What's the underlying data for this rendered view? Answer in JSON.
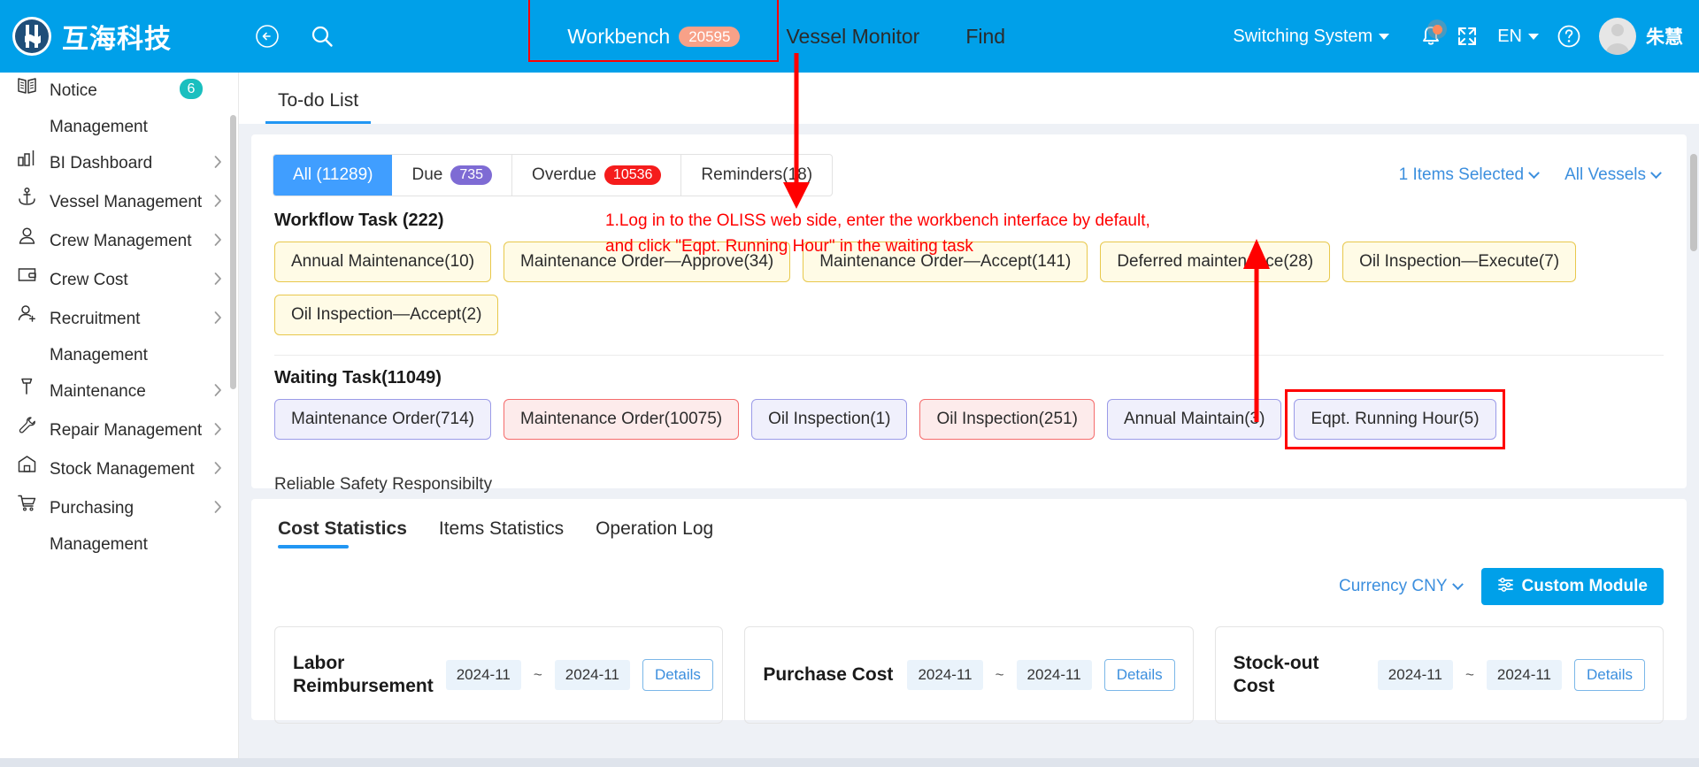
{
  "header": {
    "brand_name": "互海科技",
    "nav": [
      {
        "label": "Workbench",
        "badge": "20595",
        "active": true,
        "highlighted": true
      },
      {
        "label": "Vessel Monitor",
        "badge": "",
        "active": false,
        "highlighted": false
      },
      {
        "label": "Find",
        "badge": "",
        "active": false,
        "highlighted": false
      }
    ],
    "switching_system": "Switching System",
    "language": "EN",
    "username": "朱慧",
    "icons": {
      "back": "back-arrow-icon",
      "search": "search-icon",
      "bell": "notification-bell-icon",
      "fullscreen": "fullscreen-icon",
      "help": "help-circle-icon",
      "avatar": "user-avatar"
    },
    "accent_color": "#00A0E9",
    "badge_color": "#F8A188"
  },
  "sidebar": {
    "items": [
      {
        "label": "Notice\nManagement",
        "icon": "book-icon",
        "badge": "6",
        "chevron": false
      },
      {
        "label": "BI Dashboard",
        "icon": "bar-chart-icon",
        "badge": "",
        "chevron": true
      },
      {
        "label": "Vessel Management",
        "icon": "anchor-icon",
        "badge": "",
        "chevron": true
      },
      {
        "label": "Crew Management",
        "icon": "person-icon",
        "badge": "",
        "chevron": true
      },
      {
        "label": "Crew Cost",
        "icon": "wallet-icon",
        "badge": "",
        "chevron": true
      },
      {
        "label": "Recruitment\nManagement",
        "icon": "person-add-icon",
        "badge": "",
        "chevron": true
      },
      {
        "label": "Maintenance",
        "icon": "hammer-icon",
        "badge": "",
        "chevron": true
      },
      {
        "label": "Repair Management",
        "icon": "wrench-icon",
        "badge": "",
        "chevron": true
      },
      {
        "label": "Stock Management",
        "icon": "warehouse-icon",
        "badge": "",
        "chevron": true
      },
      {
        "label": "Purchasing\nManagement",
        "icon": "cart-icon",
        "badge": "",
        "chevron": true
      }
    ],
    "badge_color": "#1ABFBF"
  },
  "main": {
    "todo_tab": "To-do List",
    "filter_tabs": [
      {
        "label": "All (11289)",
        "pill": "",
        "active": true
      },
      {
        "label": "Due",
        "pill": "735",
        "pill_color": "purple",
        "active": false
      },
      {
        "label": "Overdue",
        "pill": "10536",
        "pill_color": "red",
        "active": false
      },
      {
        "label": "Reminders(18)",
        "pill": "",
        "active": false
      }
    ],
    "items_selected": "1 Items Selected",
    "all_vessels": "All Vessels",
    "workflow_title": "Workflow Task (222)",
    "workflow_chips": [
      {
        "label": "Annual Maintenance(10)",
        "style": "yellow"
      },
      {
        "label": "Maintenance Order—Approve(34)",
        "style": "yellow"
      },
      {
        "label": "Maintenance Order—Accept(141)",
        "style": "yellow"
      },
      {
        "label": "Deferred maintenance(28)",
        "style": "yellow"
      },
      {
        "label": "Oil Inspection—Execute(7)",
        "style": "yellow"
      },
      {
        "label": "Oil Inspection—Accept(2)",
        "style": "yellow"
      }
    ],
    "waiting_title": "Waiting Task(11049)",
    "waiting_chips": [
      {
        "label": "Maintenance Order(714)",
        "style": "blue",
        "highlighted": false
      },
      {
        "label": "Maintenance Order(10075)",
        "style": "pink",
        "highlighted": false
      },
      {
        "label": "Oil Inspection(1)",
        "style": "blue",
        "highlighted": false
      },
      {
        "label": "Oil Inspection(251)",
        "style": "pink",
        "highlighted": false
      },
      {
        "label": "Annual Maintain(3)",
        "style": "blue",
        "highlighted": false
      },
      {
        "label": "Eqpt. Running Hour(5)",
        "style": "blue",
        "highlighted": true
      }
    ],
    "reliable_safety": "Reliable Safety Responsibilty"
  },
  "stats": {
    "tabs": [
      {
        "label": "Cost Statistics",
        "active": true
      },
      {
        "label": "Items Statistics",
        "active": false
      },
      {
        "label": "Operation Log",
        "active": false
      }
    ],
    "currency": "Currency CNY",
    "custom_module": "Custom Module",
    "cost_cards": [
      {
        "name": "Labor\nReimbursement",
        "date_from": "2024-11",
        "date_to": "2024-11",
        "details": "Details"
      },
      {
        "name": "Purchase Cost",
        "date_from": "2024-11",
        "date_to": "2024-11",
        "details": "Details"
      },
      {
        "name": "Stock-out Cost",
        "date_from": "2024-11",
        "date_to": "2024-11",
        "details": "Details"
      }
    ],
    "tilde": "~"
  },
  "annotations": {
    "step1": "1.Log in to the OLISS web side, enter the workbench interface by default,\nand click \"Eqpt. Running Hour\" in the waiting task",
    "color": "#FF0000"
  }
}
